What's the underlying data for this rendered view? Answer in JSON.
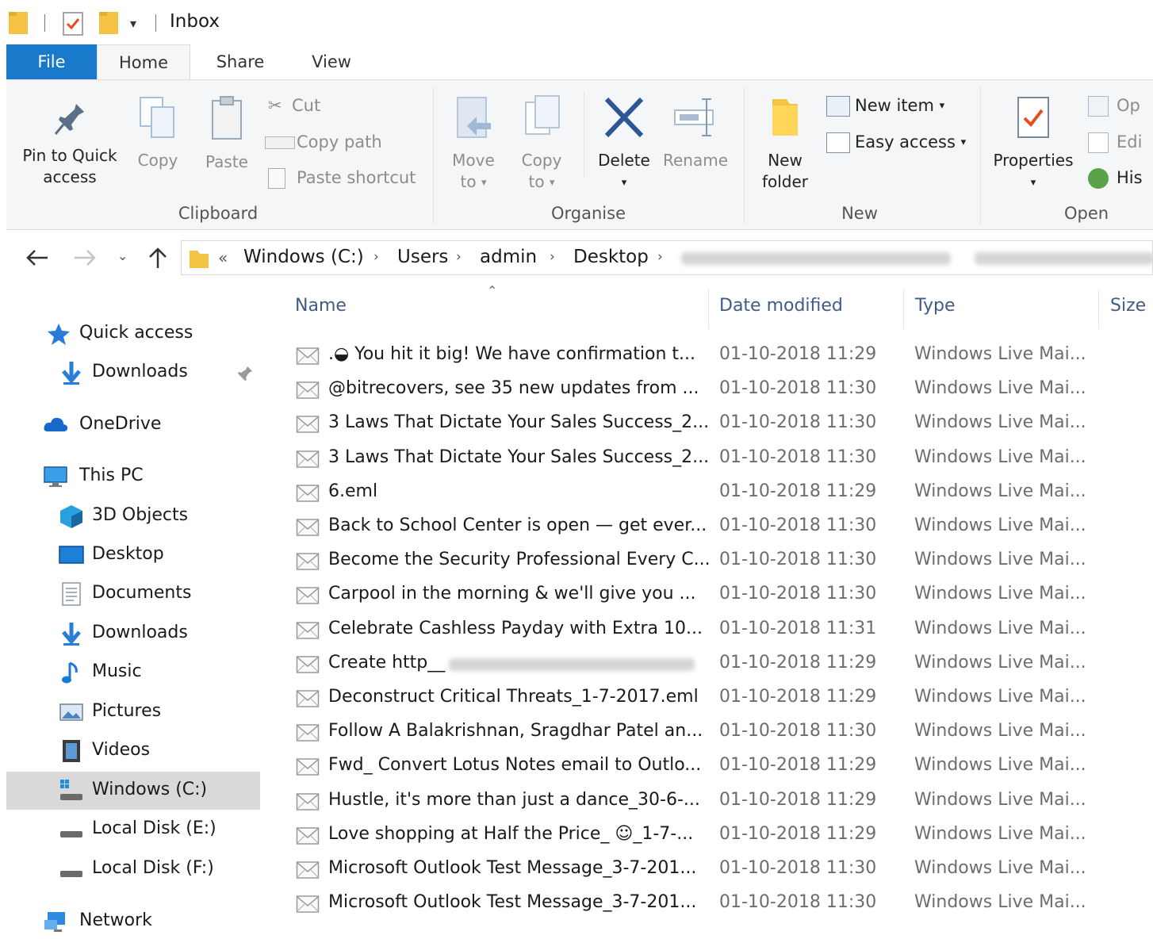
{
  "titlebar": {
    "title": "Inbox"
  },
  "tabs": {
    "file": "File",
    "home": "Home",
    "share": "Share",
    "view": "View"
  },
  "ribbon": {
    "clipboard": {
      "pin_line1": "Pin to Quick",
      "pin_line2": "access",
      "copy": "Copy",
      "paste": "Paste",
      "cut": "Cut",
      "copy_path": "Copy path",
      "paste_shortcut": "Paste shortcut",
      "group_label": "Clipboard"
    },
    "organise": {
      "move_line1": "Move",
      "move_line2": "to",
      "copy_line1": "Copy",
      "copy_line2": "to",
      "delete": "Delete",
      "rename": "Rename",
      "group_label": "Organise"
    },
    "new": {
      "new_folder_line1": "New",
      "new_folder_line2": "folder",
      "new_item": "New item",
      "easy_access": "Easy access",
      "group_label": "New"
    },
    "open": {
      "properties": "Properties",
      "open": "Op",
      "edit": "Edi",
      "history": "His",
      "group_label": "Open"
    }
  },
  "address": {
    "overflow": "«",
    "crumbs": [
      "Windows (C:)",
      "Users",
      "admin",
      "Desktop"
    ]
  },
  "sidebar": {
    "quick_access": "Quick access",
    "downloads_pinned": "Downloads",
    "onedrive": "OneDrive",
    "this_pc": "This PC",
    "items": [
      "3D Objects",
      "Desktop",
      "Documents",
      "Downloads",
      "Music",
      "Pictures",
      "Videos",
      "Windows (C:)",
      "Local Disk (E:)",
      "Local Disk (F:)"
    ],
    "network": "Network"
  },
  "columns": {
    "name": "Name",
    "date": "Date modified",
    "type": "Type",
    "size": "Size"
  },
  "files": [
    {
      "name": ".◒ You hit it big! We have confirmation t...",
      "date": "01-10-2018 11:29",
      "type": "Windows Live Mai..."
    },
    {
      "name": "@bitrecovers, see 35 new updates from ...",
      "date": "01-10-2018 11:30",
      "type": "Windows Live Mai..."
    },
    {
      "name": "3 Laws That Dictate Your Sales Success_2...",
      "date": "01-10-2018 11:30",
      "type": "Windows Live Mai..."
    },
    {
      "name": "3 Laws That Dictate Your Sales Success_2...",
      "date": "01-10-2018 11:30",
      "type": "Windows Live Mai..."
    },
    {
      "name": "6.eml",
      "date": "01-10-2018 11:29",
      "type": "Windows Live Mai..."
    },
    {
      "name": "Back to School Center is open — get ever...",
      "date": "01-10-2018 11:30",
      "type": "Windows Live Mai..."
    },
    {
      "name": "Become the Security Professional Every C...",
      "date": "01-10-2018 11:30",
      "type": "Windows Live Mai..."
    },
    {
      "name": "Carpool in the morning & we'll give you ...",
      "date": "01-10-2018 11:30",
      "type": "Windows Live Mai..."
    },
    {
      "name": "Celebrate Cashless Payday with Extra 10...",
      "date": "01-10-2018 11:31",
      "type": "Windows Live Mai..."
    },
    {
      "name": "Create http__",
      "date": "01-10-2018 11:29",
      "type": "Windows Live Mai..."
    },
    {
      "name": "Deconstruct Critical Threats_1-7-2017.eml",
      "date": "01-10-2018 11:29",
      "type": "Windows Live Mai..."
    },
    {
      "name": "Follow A Balakrishnan, Sragdhar Patel an...",
      "date": "01-10-2018 11:30",
      "type": "Windows Live Mai..."
    },
    {
      "name": "Fwd_ Convert Lotus Notes email to Outlo...",
      "date": "01-10-2018 11:29",
      "type": "Windows Live Mai..."
    },
    {
      "name": "Hustle, it's more than just a dance_30-6-...",
      "date": "01-10-2018 11:29",
      "type": "Windows Live Mai..."
    },
    {
      "name": "Love shopping at Half the Price_ ☺_1-7-...",
      "date": "01-10-2018 11:29",
      "type": "Windows Live Mai..."
    },
    {
      "name": "Microsoft Outlook Test Message_3-7-201...",
      "date": "01-10-2018 11:30",
      "type": "Windows Live Mai..."
    },
    {
      "name": "Microsoft Outlook Test Message_3-7-201...",
      "date": "01-10-2018 11:30",
      "type": "Windows Live Mai..."
    }
  ]
}
